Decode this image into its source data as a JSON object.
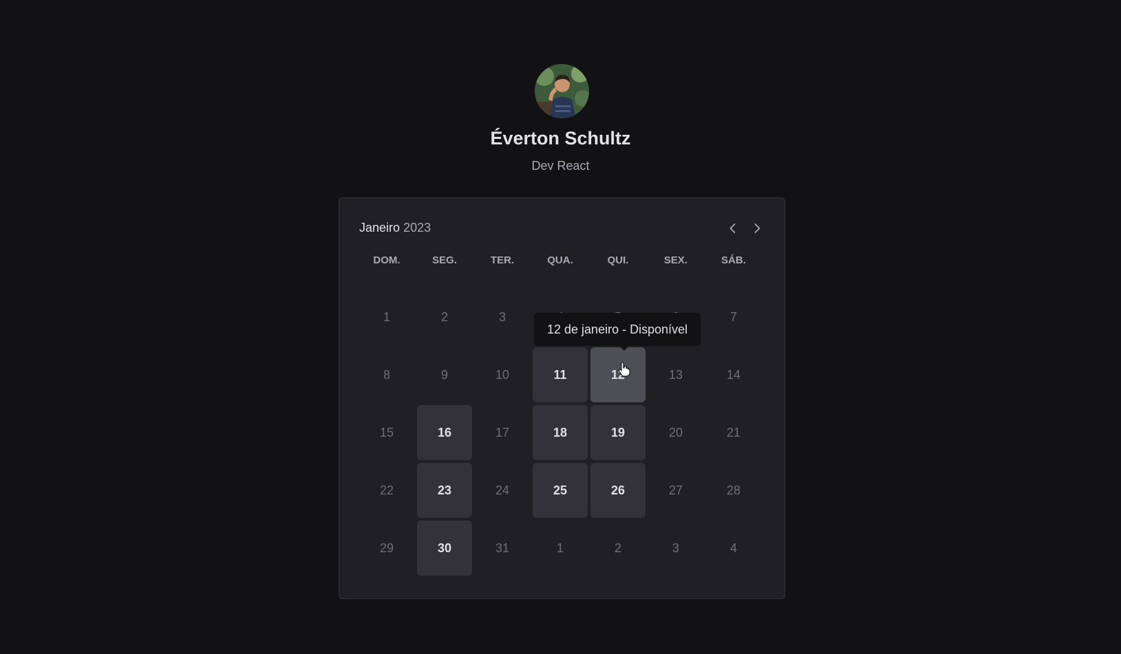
{
  "profile": {
    "avatar_icon": "user-photo",
    "name": "Éverton Schultz",
    "role": "Dev React"
  },
  "calendar": {
    "month": "Janeiro",
    "year": "2023",
    "prev_icon": "chevron-left-icon",
    "next_icon": "chevron-right-icon",
    "weekdays": [
      "DOM.",
      "SEG.",
      "TER.",
      "QUA.",
      "QUI.",
      "SEX.",
      "SÁB."
    ],
    "weeks": [
      [
        {
          "day": "1",
          "available": false
        },
        {
          "day": "2",
          "available": false
        },
        {
          "day": "3",
          "available": false
        },
        {
          "day": "4",
          "available": false
        },
        {
          "day": "5",
          "available": false
        },
        {
          "day": "6",
          "available": false
        },
        {
          "day": "7",
          "available": false
        }
      ],
      [
        {
          "day": "8",
          "available": false
        },
        {
          "day": "9",
          "available": false
        },
        {
          "day": "10",
          "available": false
        },
        {
          "day": "11",
          "available": true
        },
        {
          "day": "12",
          "available": true,
          "hovered": true
        },
        {
          "day": "13",
          "available": false
        },
        {
          "day": "14",
          "available": false
        }
      ],
      [
        {
          "day": "15",
          "available": false
        },
        {
          "day": "16",
          "available": true
        },
        {
          "day": "17",
          "available": false
        },
        {
          "day": "18",
          "available": true
        },
        {
          "day": "19",
          "available": true
        },
        {
          "day": "20",
          "available": false
        },
        {
          "day": "21",
          "available": false
        }
      ],
      [
        {
          "day": "22",
          "available": false
        },
        {
          "day": "23",
          "available": true
        },
        {
          "day": "24",
          "available": false
        },
        {
          "day": "25",
          "available": true
        },
        {
          "day": "26",
          "available": true
        },
        {
          "day": "27",
          "available": false
        },
        {
          "day": "28",
          "available": false
        }
      ],
      [
        {
          "day": "29",
          "available": false
        },
        {
          "day": "30",
          "available": true
        },
        {
          "day": "31",
          "available": false
        },
        {
          "day": "1",
          "available": false
        },
        {
          "day": "2",
          "available": false
        },
        {
          "day": "3",
          "available": false
        },
        {
          "day": "4",
          "available": false
        }
      ]
    ],
    "tooltip": "12 de janeiro - Disponível"
  },
  "colors": {
    "background": "#121214",
    "card": "#202024",
    "available_day": "#323238",
    "hovered_day": "#4e4e56",
    "muted_text": "#6e6e78"
  }
}
